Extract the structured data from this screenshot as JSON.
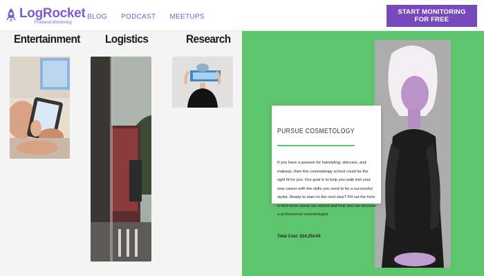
{
  "header": {
    "logo_name": "LogRocket",
    "logo_tagline": "Frontend Monitoring",
    "nav": [
      "BLOG",
      "PODCAST",
      "MEETUPS"
    ],
    "cta_label": "START MONITORING FOR FREE",
    "brand_color": "#764abc"
  },
  "categories": [
    {
      "title": "Entertainment"
    },
    {
      "title": "Logistics"
    },
    {
      "title": "Research"
    }
  ],
  "promo": {
    "title": "PURSUE COSMETOLOGY",
    "body": "If you have a passion for hairstyling, skincare, and makeup, then this cosmetology school could be the right fit for you. Our goal is to help you walk into your new career with the skills you need to be a successful stylist. Ready to start on the next step? Fill out the form to find more about our school and how you can become a professional cosmetologist.",
    "total_cost": "Total Cost: $24,254.00",
    "accent_color": "#5ec56f"
  }
}
